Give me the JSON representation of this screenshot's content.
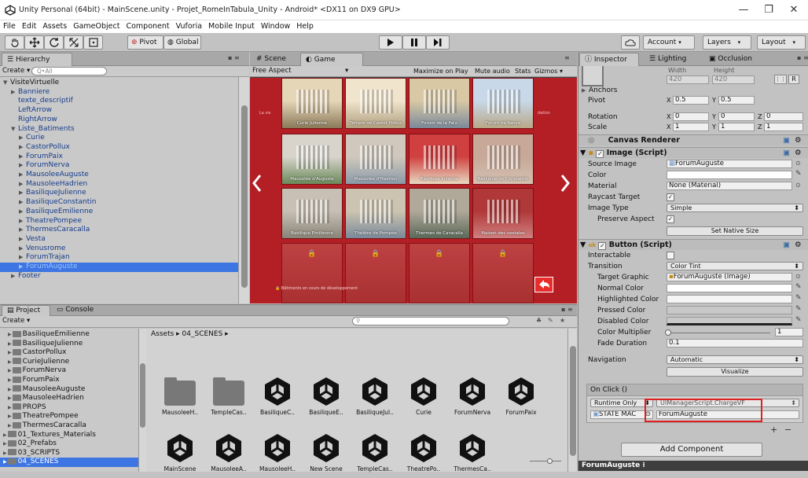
{
  "window": {
    "title": "Unity Personal (64bit) - MainScene.unity - Projet_RomeInTabula_Unity - Android* <DX11 on DX9 GPU>",
    "minimize": "—",
    "maximize": "❐",
    "close": "✕"
  },
  "menu": [
    "File",
    "Edit",
    "Assets",
    "GameObject",
    "Component",
    "Vuforia",
    "Mobile Input",
    "Window",
    "Help"
  ],
  "toolbar": {
    "pivot": "Pivot",
    "global": "Global",
    "account": "Account",
    "layers": "Layers",
    "layout": "Layout"
  },
  "hierarchy": {
    "tab": "Hierarchy",
    "create": "Create",
    "search_placeholder": "Q•All",
    "rows": [
      {
        "label": "VisiteVirtuelle",
        "indent": 0,
        "open": true
      },
      {
        "label": "Banniere",
        "indent": 1,
        "arrow": true
      },
      {
        "label": "texte_descriptif",
        "indent": 1
      },
      {
        "label": "LeftArrow",
        "indent": 1
      },
      {
        "label": "RightArrow",
        "indent": 1
      },
      {
        "label": "Liste_Batiments",
        "indent": 1,
        "open": true
      },
      {
        "label": "Curie",
        "indent": 2,
        "arrow": true
      },
      {
        "label": "CastorPollux",
        "indent": 2,
        "arrow": true
      },
      {
        "label": "ForumPaix",
        "indent": 2,
        "arrow": true
      },
      {
        "label": "ForumNerva",
        "indent": 2,
        "arrow": true
      },
      {
        "label": "MausoleeAuguste",
        "indent": 2,
        "arrow": true
      },
      {
        "label": "MausoleeHadrien",
        "indent": 2,
        "arrow": true
      },
      {
        "label": "BasiliqueJulienne",
        "indent": 2,
        "arrow": true
      },
      {
        "label": "BasiliqueConstantin",
        "indent": 2,
        "arrow": true
      },
      {
        "label": "BasiliqueEmilienne",
        "indent": 2,
        "arrow": true
      },
      {
        "label": "TheatrePompee",
        "indent": 2,
        "arrow": true
      },
      {
        "label": "ThermesCaracalla",
        "indent": 2,
        "arrow": true
      },
      {
        "label": "Vesta",
        "indent": 2,
        "arrow": true
      },
      {
        "label": "Venusrome",
        "indent": 2,
        "arrow": true
      },
      {
        "label": "ForumTrajan",
        "indent": 2,
        "arrow": true
      },
      {
        "label": "ForumAuguste",
        "indent": 2,
        "arrow": true,
        "selected": true
      },
      {
        "label": "Footer",
        "indent": 1,
        "arrow": true
      }
    ]
  },
  "sceneTabs": {
    "scene": "Scene",
    "game": "Game",
    "aspect": "Free Aspect",
    "maximize": "Maximize on Play",
    "mute": "Mute audio",
    "stats": "Stats",
    "gizmos": "Gizmos"
  },
  "game": {
    "tiles": [
      "Curie Julienne",
      "Temple de Castor Pollux",
      "Forum de la Paix",
      "Forum de Nerva",
      "Mausolée d'Auguste",
      "Mausolée d'Hadrien",
      "Basilique Julienne",
      "Basilique de Constantin",
      "Basilique Emilienne",
      "Théâtre de Pompée",
      "Thermes de Caracalla",
      "Maison des vestales"
    ],
    "left_text": "La vis",
    "right_text": "dation",
    "bottom_text": "Bâtiments en cours de développement",
    "colors": {
      "bg": "#b31f24"
    }
  },
  "inspector": {
    "tabs": [
      "Inspector",
      "Lighting",
      "Occlusion"
    ],
    "width_label": "Width",
    "height_label": "Height",
    "width_val": "420",
    "height_val": "420",
    "r_btn": "R",
    "anchors": "Anchors",
    "pivot": "Pivot",
    "pivot_x": "0.5",
    "pivot_y": "0.5",
    "rotation": "Rotation",
    "rot_x": "0",
    "rot_y": "0",
    "rot_z": "0",
    "scale": "Scale",
    "scale_x": "1",
    "scale_y": "1",
    "scale_z": "1",
    "canvas_renderer": "Canvas Renderer",
    "image_script": "Image (Script)",
    "source_image": "Source Image",
    "source_image_val": "ForumAuguste",
    "color": "Color",
    "material": "Material",
    "material_val": "None (Material)",
    "raycast": "Raycast Target",
    "image_type": "Image Type",
    "image_type_val": "Simple",
    "preserve": "Preserve Aspect",
    "set_native": "Set Native Size",
    "button_script": "Button (Script)",
    "interactable": "Interactable",
    "transition": "Transition",
    "transition_val": "Color Tint",
    "target_graphic": "Target Graphic",
    "target_graphic_val": "ForumAuguste (Image)",
    "normal_color": "Normal Color",
    "highlighted_color": "Highlighted Color",
    "pressed_color": "Pressed Color",
    "disabled_color": "Disabled Color",
    "color_multiplier": "Color Multiplier",
    "color_multiplier_val": "1",
    "fade_duration": "Fade Duration",
    "fade_duration_val": "0.1",
    "navigation": "Navigation",
    "navigation_val": "Automatic",
    "visualize": "Visualize",
    "onclick": "On Click ()",
    "runtime": "Runtime Only",
    "function": "UIManagerScript.ChargeVF",
    "object": "STATE MAC",
    "argument": "ForumAuguste",
    "add_component": "Add Component",
    "footer": "ForumAuguste"
  },
  "project": {
    "tabs": [
      "Project",
      "Console"
    ],
    "create": "Create",
    "breadcrumb": "Assets ▸ 04_SCENES ▸",
    "tree": [
      {
        "label": "BasiliqueEmilienne",
        "indent": 1
      },
      {
        "label": "BasiliqueJulienne",
        "indent": 1
      },
      {
        "label": "CastorPollux",
        "indent": 1
      },
      {
        "label": "CurieJulienne",
        "indent": 1
      },
      {
        "label": "ForumNerva",
        "indent": 1
      },
      {
        "label": "ForumPaix",
        "indent": 1
      },
      {
        "label": "MausoleeAuguste",
        "indent": 1
      },
      {
        "label": "MausoleeHadrien",
        "indent": 1
      },
      {
        "label": "PROPS",
        "indent": 1
      },
      {
        "label": "TheatrePompee",
        "indent": 1
      },
      {
        "label": "ThermesCaracalla",
        "indent": 1
      },
      {
        "label": "01_Textures_Materials",
        "indent": 0
      },
      {
        "label": "02_Prefabs",
        "indent": 0
      },
      {
        "label": "03_SCRIPTS",
        "indent": 0
      },
      {
        "label": "04_SCENES",
        "indent": 0,
        "selected": true
      }
    ],
    "assets_row1": [
      {
        "label": "MausoleeH..",
        "type": "folder"
      },
      {
        "label": "TempleCas..",
        "type": "folder"
      },
      {
        "label": "BasiliqueC..",
        "type": "unity"
      },
      {
        "label": "BasiliqueE..",
        "type": "unity"
      },
      {
        "label": "BasiliqueJul..",
        "type": "unity"
      },
      {
        "label": "Curie",
        "type": "unity"
      },
      {
        "label": "ForumNerva",
        "type": "unity"
      },
      {
        "label": "ForumPaix",
        "type": "unity"
      }
    ],
    "assets_row2": [
      {
        "label": "MainScene",
        "type": "unity"
      },
      {
        "label": "MausoleeA..",
        "type": "unity"
      },
      {
        "label": "MausoleeH..",
        "type": "unity"
      },
      {
        "label": "New Scene",
        "type": "unity"
      },
      {
        "label": "TempleCas..",
        "type": "unity"
      },
      {
        "label": "TheatrePo..",
        "type": "unity"
      },
      {
        "label": "ThermesCa..",
        "type": "unity"
      }
    ]
  },
  "colors": {
    "highlight_red": "#e02020",
    "selection_blue": "#3d76e3"
  }
}
